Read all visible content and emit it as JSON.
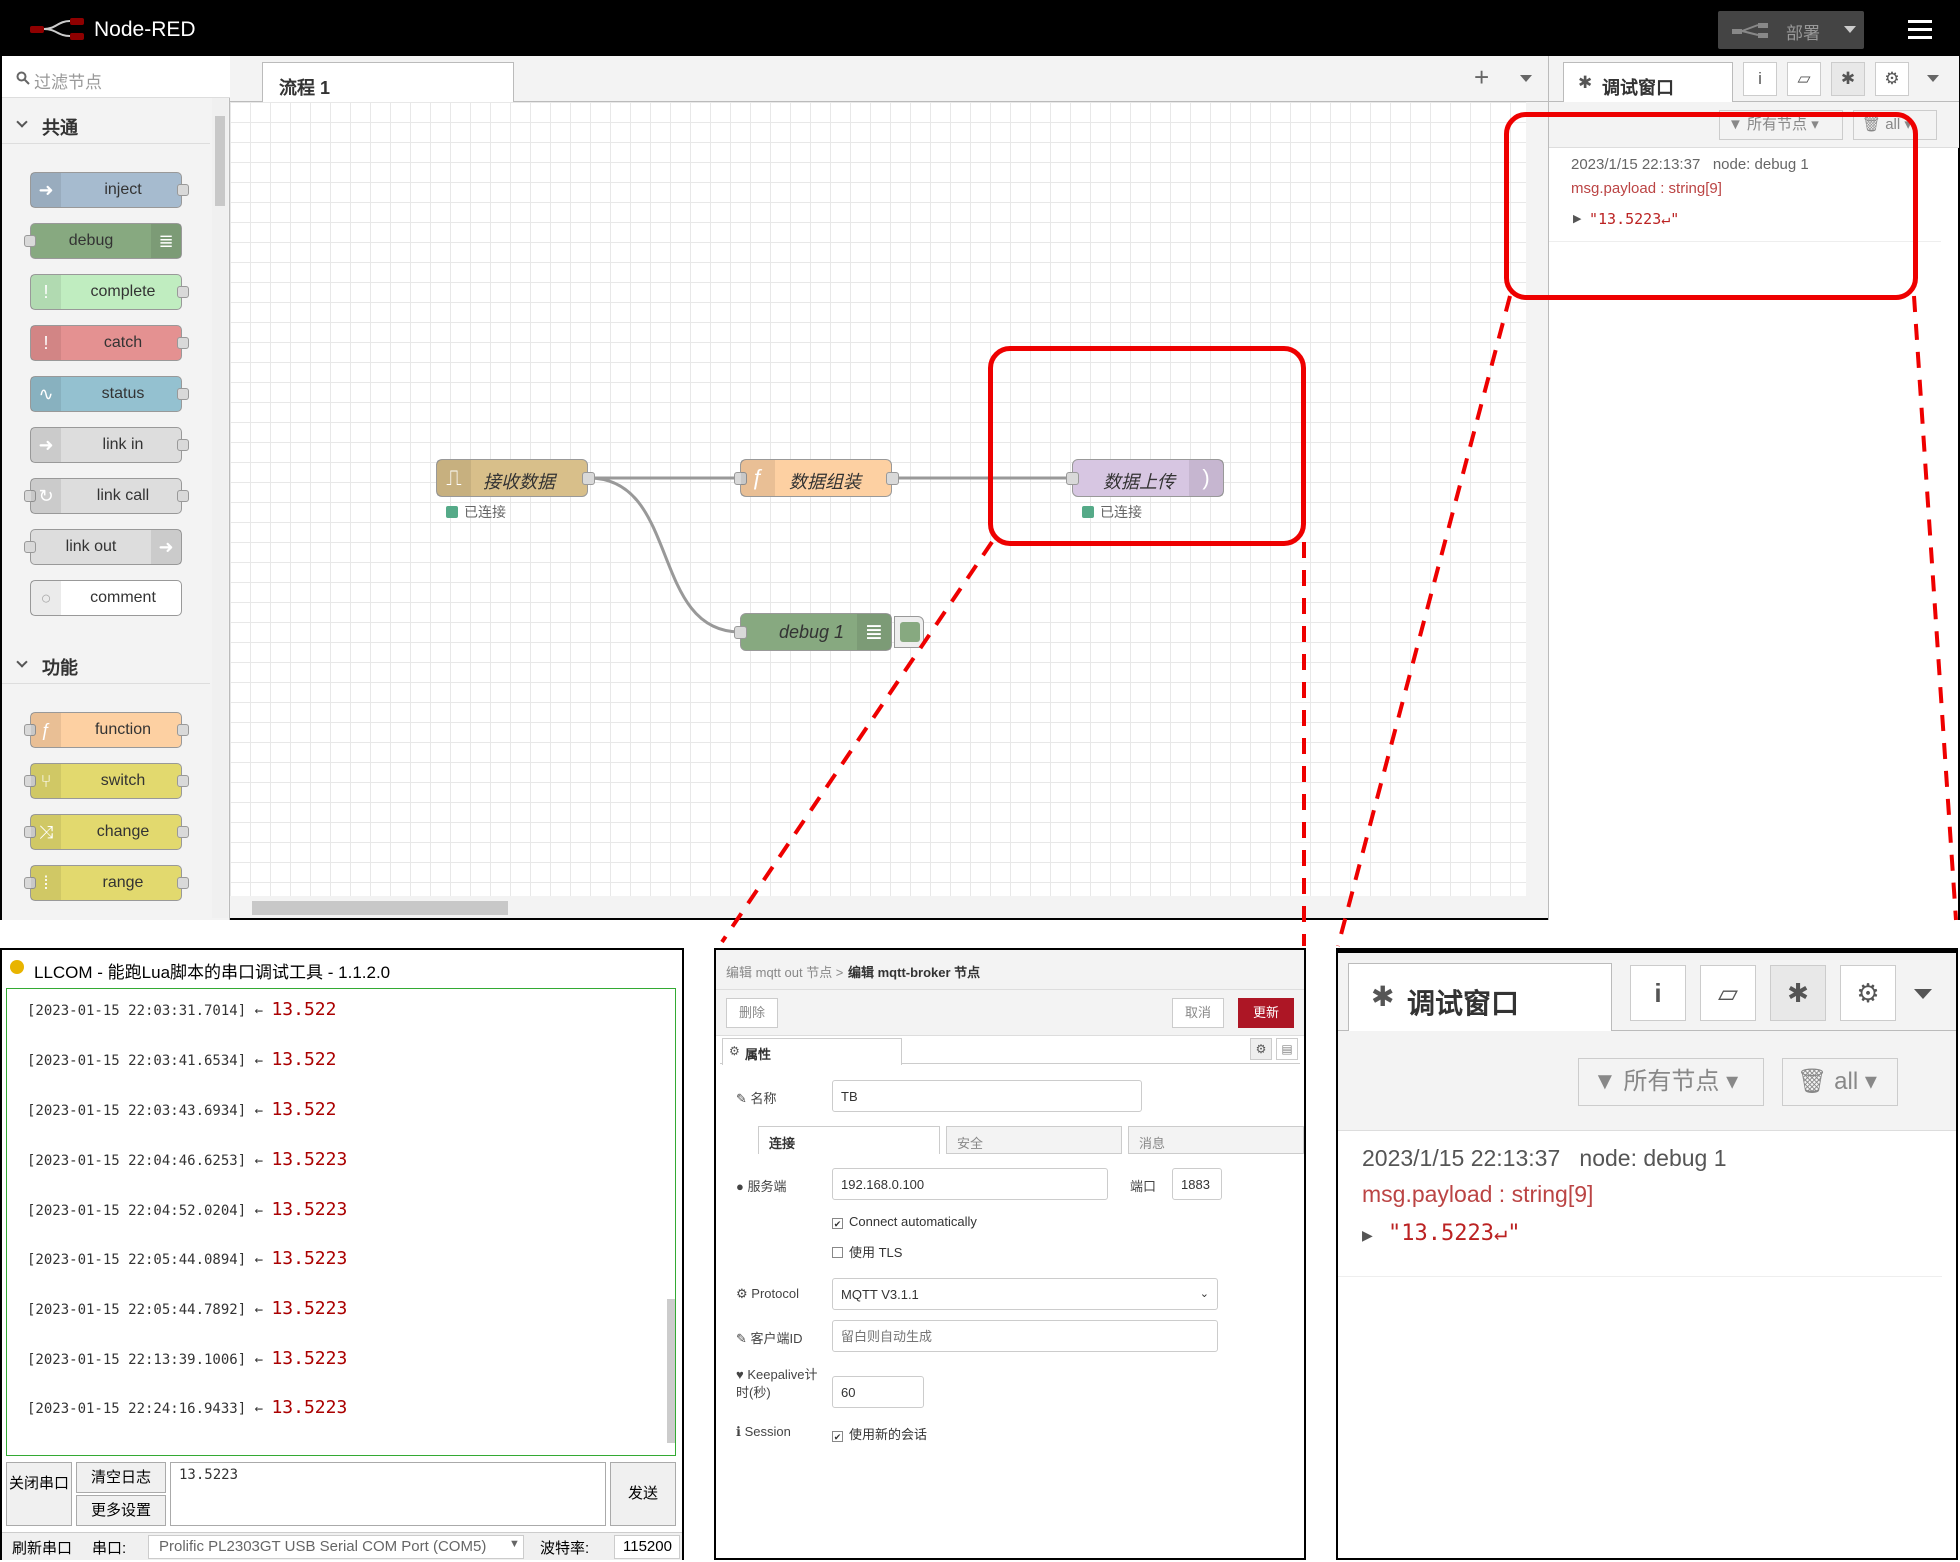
{
  "nodered": {
    "app_title": "Node-RED",
    "deploy_label": "部署",
    "palette": {
      "filter_placeholder": "过滤节点",
      "categories": [
        {
          "label": "共通",
          "nodes": [
            "inject",
            "debug",
            "complete",
            "catch",
            "status",
            "link in",
            "link call",
            "link out",
            "comment"
          ]
        },
        {
          "label": "功能",
          "nodes": [
            "function",
            "switch",
            "change",
            "range"
          ]
        }
      ]
    },
    "flow_tab": "流程 1",
    "flow_nodes": {
      "receive": {
        "label": "接收数据",
        "status": "已连接"
      },
      "assemble": {
        "label": "数据组装"
      },
      "upload": {
        "label": "数据上传",
        "status": "已连接"
      },
      "debug": {
        "label": "debug 1"
      }
    },
    "sidebar": {
      "tab_label": "调试窗口",
      "filter_label": "所有节点",
      "clear_label": "all",
      "message": {
        "time": "2023/1/15 22:13:37",
        "node": "node: debug 1",
        "path": "msg.payload : string[9]",
        "value": "\"13.5223↵\""
      }
    }
  },
  "llcom": {
    "title": "LLCOM - 能跑Lua脚本的串口调试工具 - 1.1.2.0",
    "log": [
      {
        "ts": "[2023-01-15 22:03:31.7014] ←",
        "val": "13.522"
      },
      {
        "ts": "[2023-01-15 22:03:41.6534] ←",
        "val": "13.522"
      },
      {
        "ts": "[2023-01-15 22:03:43.6934] ←",
        "val": "13.522"
      },
      {
        "ts": "[2023-01-15 22:04:46.6253] ←",
        "val": "13.5223"
      },
      {
        "ts": "[2023-01-15 22:04:52.0204] ←",
        "val": "13.5223"
      },
      {
        "ts": "[2023-01-15 22:05:44.0894] ←",
        "val": "13.5223"
      },
      {
        "ts": "[2023-01-15 22:05:44.7892] ←",
        "val": "13.5223"
      },
      {
        "ts": "[2023-01-15 22:13:39.1006] ←",
        "val": "13.5223"
      },
      {
        "ts": "[2023-01-15 22:24:16.9433] ←",
        "val": "13.5223"
      }
    ],
    "close_port": "关闭串口",
    "clear_log": "清空日志",
    "more_settings": "更多设置",
    "send_text": "13.5223",
    "send": "发送",
    "status": {
      "refresh": "刷新串口",
      "port_label": "串口:",
      "port_value": "Prolific PL2303GT USB Serial COM Port (COM5)",
      "baud_label": "波特率:",
      "baud_value": "115200"
    }
  },
  "mqtt": {
    "breadcrumb_prev": "编辑 mqtt out 节点 >",
    "breadcrumb_current": "编辑 mqtt-broker 节点",
    "delete": "删除",
    "cancel": "取消",
    "update": "更新",
    "props_tab": "属性",
    "name_label": "名称",
    "name_value": "TB",
    "subtabs": [
      "连接",
      "安全",
      "消息"
    ],
    "server_label": "服务端",
    "server_value": "192.168.0.100",
    "port_label": "端口",
    "port_value": "1883",
    "auto_connect": "Connect automatically",
    "use_tls": "使用 TLS",
    "protocol_label": "Protocol",
    "protocol_value": "MQTT V3.1.1",
    "client_id_label": "客户端ID",
    "client_id_placeholder": "留白则自动生成",
    "keepalive_label": "Keepalive计时(秒)",
    "keepalive_value": "60",
    "session_label": "Session",
    "session_value": "使用新的会话"
  },
  "zoom": {
    "tab_label": "调试窗口",
    "filter_label": "所有节点",
    "clear_label": "all",
    "time": "2023/1/15 22:13:37",
    "node": "node: debug 1",
    "path": "msg.payload : string[9]",
    "value": "\"13.5223↵\""
  }
}
